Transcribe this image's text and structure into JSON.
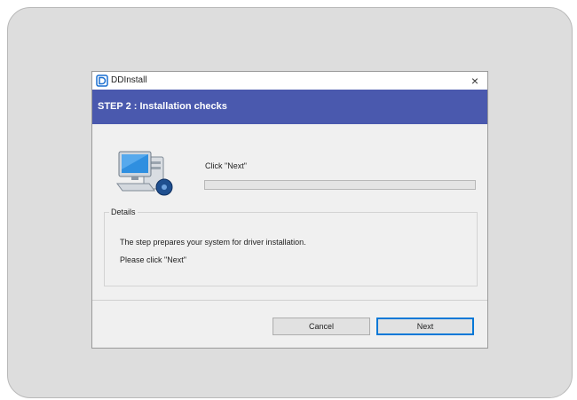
{
  "window": {
    "title": "DDInstall",
    "close_label": "×"
  },
  "banner": {
    "step_title": "STEP 2 :  Installation checks"
  },
  "status": {
    "text": "Click \"Next\"",
    "progress": 0
  },
  "details": {
    "legend": "Details",
    "line1": "The step prepares your system for driver installation.",
    "line2": "Please click \"Next\""
  },
  "buttons": {
    "cancel": "Cancel",
    "next": "Next"
  },
  "colors": {
    "banner": "#4a59ae",
    "frame": "#dddddd",
    "dialog": "#f0f0f0",
    "default_button_border": "#0078d7"
  },
  "icons": {
    "app": "ddinstall-app-icon",
    "illustration": "computer-setup-icon",
    "close": "close-icon"
  }
}
